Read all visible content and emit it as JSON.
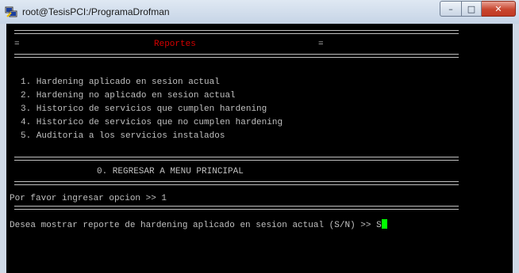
{
  "window": {
    "title": "root@TesisPCI:/ProgramaDrofman",
    "buttons": {
      "minimize": "–",
      "maximize": "□",
      "close": "✕"
    }
  },
  "terminal": {
    "header_left": "=",
    "header_title": "Reportes",
    "header_right": "=",
    "menu": [
      "1. Hardening aplicado en sesion actual",
      "2. Hardening no aplicado en sesion actual",
      "3. Historico de servicios que cumplen hardening",
      "4. Historico de servicios que no cumplen hardening",
      "5. Auditoria a los servicios instalados"
    ],
    "back_option": "0. REGRESAR A MENU PRINCIPAL",
    "prompt": "Por favor ingresar opcion >> 1",
    "question": "Desea mostrar reporte de hardening aplicado en sesion actual (S/N) >> S"
  },
  "colors": {
    "title_accent": "#d40000",
    "cursor": "#00ff00",
    "text": "#c0c0c0"
  }
}
